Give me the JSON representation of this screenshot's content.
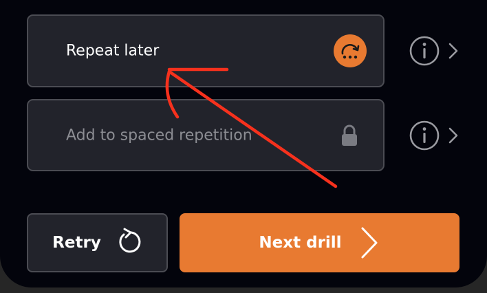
{
  "options": [
    {
      "label": "Repeat later",
      "icon": "repeat-later-icon",
      "locked": false
    },
    {
      "label": "Add to spaced repetition",
      "icon": "lock-icon",
      "locked": true
    }
  ],
  "actions": {
    "retry_label": "Retry",
    "next_label": "Next drill"
  },
  "colors": {
    "accent": "#e87a31",
    "panel_background": "#03040c",
    "card_background": "#22232b",
    "annotation_arrow": "#f6311d"
  }
}
